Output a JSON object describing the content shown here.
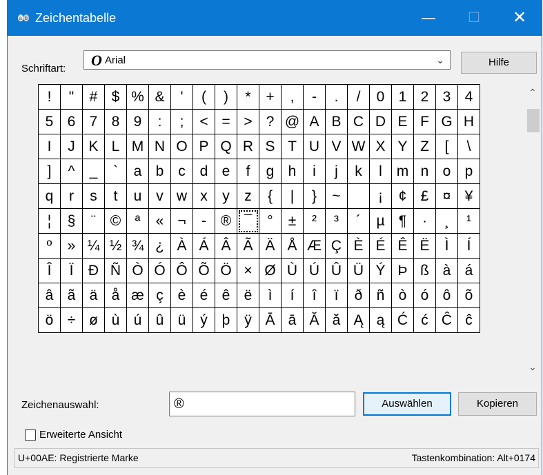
{
  "window": {
    "title": "Zeichentabelle",
    "controls": {
      "minimize": "—",
      "maximize": "☐",
      "close": "✕"
    }
  },
  "font": {
    "label": "Schriftart:",
    "value": "Arial",
    "icon_glyph": "O"
  },
  "help_label": "Hilfe",
  "grid": {
    "selected_row": 5,
    "selected_col": 9,
    "rows": [
      [
        "!",
        "\"",
        "#",
        "$",
        "%",
        "&",
        "'",
        "(",
        ")",
        "*",
        "+",
        ",",
        "-",
        ".",
        "/",
        "0",
        "1",
        "2",
        "3",
        "4"
      ],
      [
        "5",
        "6",
        "7",
        "8",
        "9",
        ":",
        ";",
        "<",
        "=",
        ">",
        "?",
        "@",
        "A",
        "B",
        "C",
        "D",
        "E",
        "F",
        "G",
        "H"
      ],
      [
        "I",
        "J",
        "K",
        "L",
        "M",
        "N",
        "O",
        "P",
        "Q",
        "R",
        "S",
        "T",
        "U",
        "V",
        "W",
        "X",
        "Y",
        "Z",
        "[",
        "\\"
      ],
      [
        "]",
        "^",
        "_",
        "`",
        "a",
        "b",
        "c",
        "d",
        "e",
        "f",
        "g",
        "h",
        "i",
        "j",
        "k",
        "l",
        "m",
        "n",
        "o",
        "p"
      ],
      [
        "q",
        "r",
        "s",
        "t",
        "u",
        "v",
        "w",
        "x",
        "y",
        "z",
        "{",
        "|",
        "}",
        "~",
        " ",
        "¡",
        "¢",
        "£",
        "¤",
        "¥"
      ],
      [
        "¦",
        "§",
        "¨",
        "©",
        "ª",
        "«",
        "¬",
        "-",
        "®",
        "¯",
        "°",
        "±",
        "²",
        "³",
        "´",
        "µ",
        "¶",
        "·",
        "¸",
        "¹"
      ],
      [
        "º",
        "»",
        "¼",
        "½",
        "¾",
        "¿",
        "À",
        "Á",
        "Â",
        "Ã",
        "Ä",
        "Å",
        "Æ",
        "Ç",
        "È",
        "É",
        "Ê",
        "Ë",
        "Ì",
        "Í"
      ],
      [
        "Î",
        "Ï",
        "Ð",
        "Ñ",
        "Ò",
        "Ó",
        "Ô",
        "Õ",
        "Ö",
        "×",
        "Ø",
        "Ù",
        "Ú",
        "Û",
        "Ü",
        "Ý",
        "Þ",
        "ß",
        "à",
        "á"
      ],
      [
        "â",
        "ã",
        "ä",
        "å",
        "æ",
        "ç",
        "è",
        "é",
        "ê",
        "ë",
        "ì",
        "í",
        "î",
        "ï",
        "ð",
        "ñ",
        "ò",
        "ó",
        "ô",
        "õ"
      ],
      [
        "ö",
        "÷",
        "ø",
        "ù",
        "ú",
        "û",
        "ü",
        "ý",
        "þ",
        "ÿ",
        "Ā",
        "ā",
        "Ă",
        "ă",
        "Ą",
        "ą",
        "Ć",
        "ć",
        "Ĉ",
        "ĉ"
      ]
    ]
  },
  "selection": {
    "label": "Zeichenauswahl:",
    "value": "®",
    "select_button": "Auswählen",
    "copy_button": "Kopieren"
  },
  "advanced_view": {
    "label": "Erweiterte Ansicht",
    "checked": false
  },
  "status": {
    "left": "U+00AE: Registrierte Marke",
    "right": "Tastenkombination: Alt+0174"
  },
  "colors": {
    "titlebar": "#0b78d4",
    "accent": "#0078d7"
  }
}
